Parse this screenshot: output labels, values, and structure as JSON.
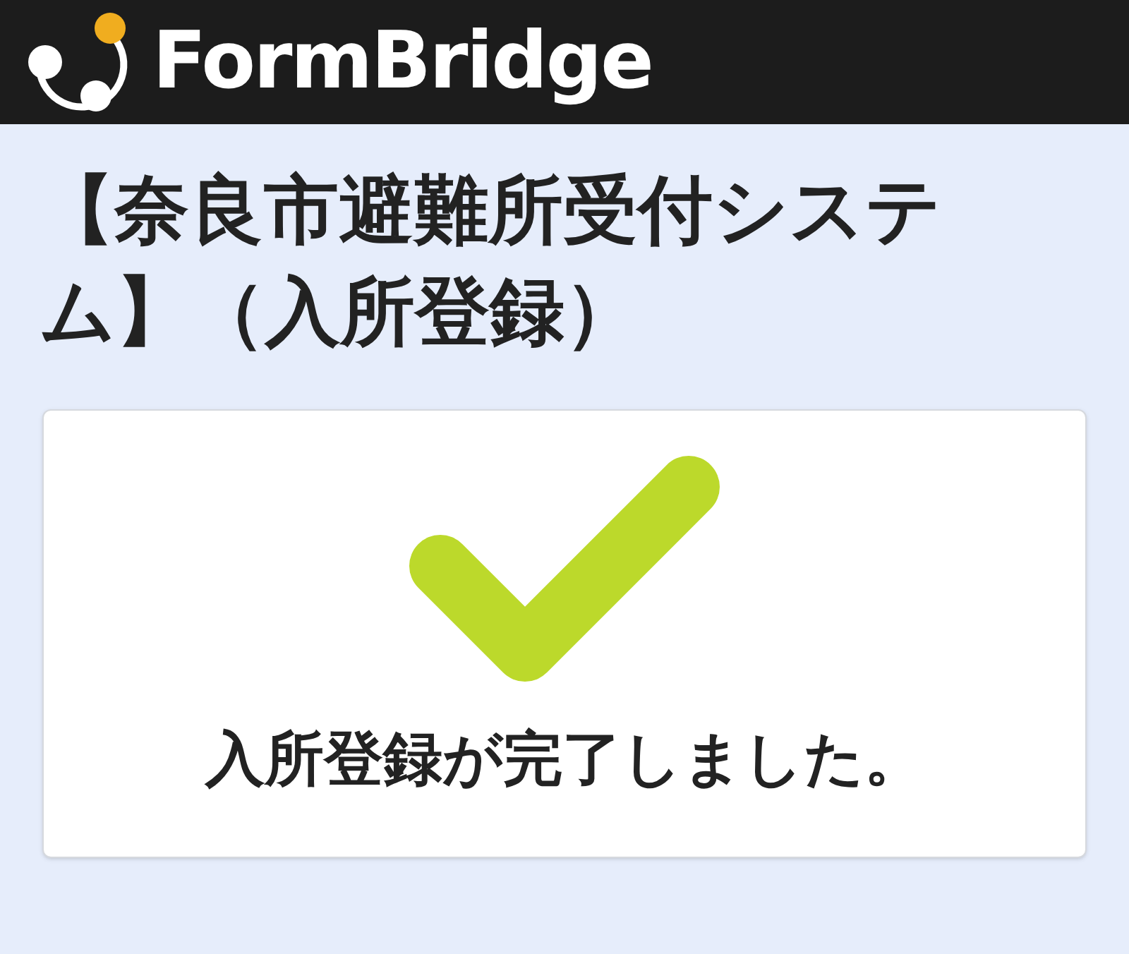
{
  "header": {
    "logo_text": "FormBridge"
  },
  "title": "【奈良市避難所受付システム】（入所登録）",
  "card": {
    "message": "入所登録が完了しました。"
  }
}
